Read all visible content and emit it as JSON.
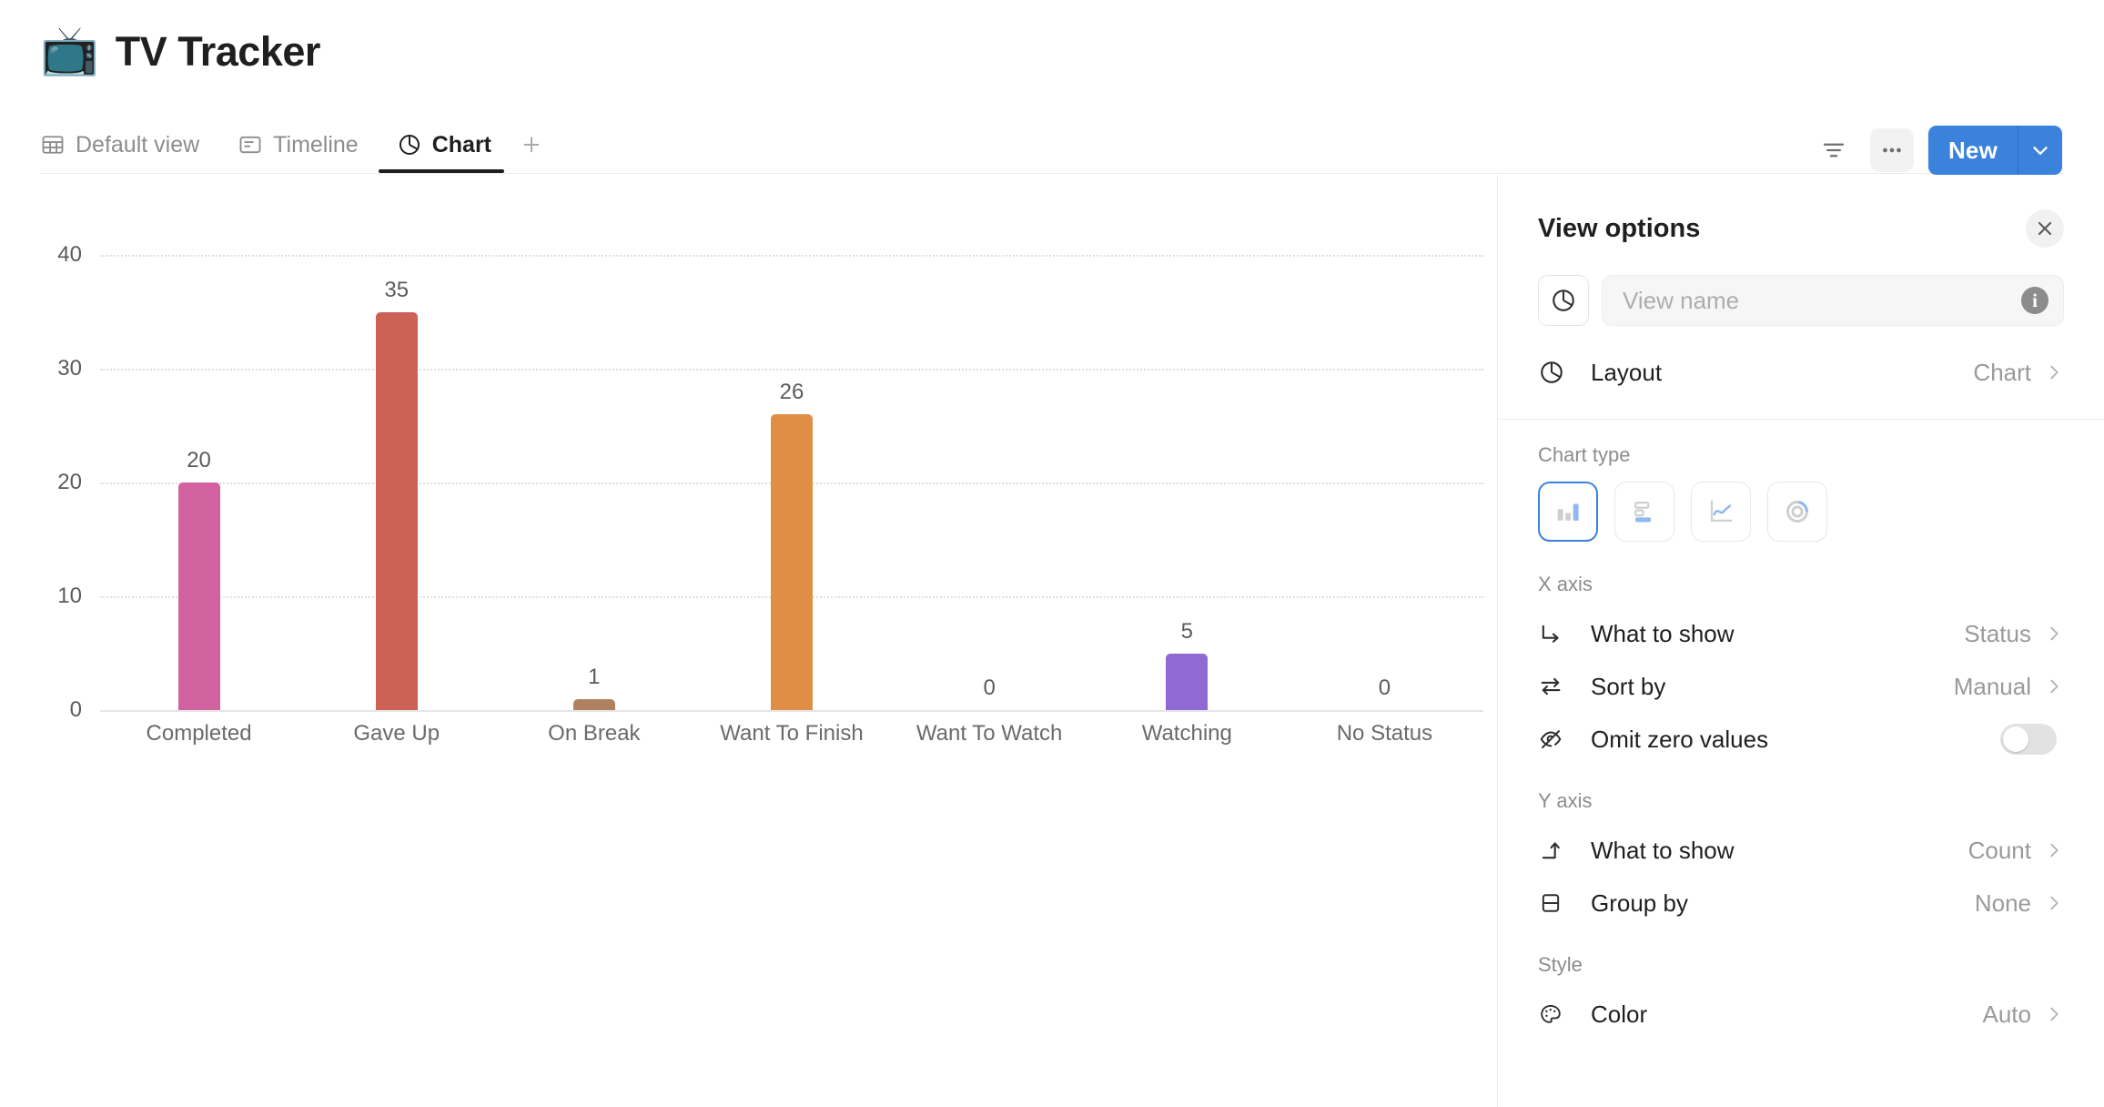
{
  "header": {
    "emoji": "📺",
    "title": "TV Tracker"
  },
  "tabs": [
    {
      "label": "Default view",
      "icon": "table-icon",
      "active": false
    },
    {
      "label": "Timeline",
      "icon": "timeline-icon",
      "active": false
    },
    {
      "label": "Chart",
      "icon": "chart-pie-icon",
      "active": true
    }
  ],
  "tabbar": {
    "add_label": "+"
  },
  "toolbar": {
    "filter_icon": "filter-icon",
    "more_icon": "ellipsis-icon",
    "new_label": "New",
    "new_caret_icon": "chevron-down-icon",
    "accent_color": "#3b82dd"
  },
  "panel": {
    "title": "View options",
    "close_icon": "close-icon",
    "view_name_value": "",
    "view_name_placeholder": "View name",
    "view_name_icon": "chart-pie-icon",
    "info_icon": "info-icon",
    "layout": {
      "label": "Layout",
      "value": "Chart",
      "icon": "chart-pie-icon"
    },
    "chart_type": {
      "section_label": "Chart type",
      "options": [
        {
          "name": "column-chart-icon",
          "selected": true
        },
        {
          "name": "bar-chart-icon",
          "selected": false
        },
        {
          "name": "line-chart-icon",
          "selected": false
        },
        {
          "name": "donut-chart-icon",
          "selected": false
        }
      ]
    },
    "x_axis": {
      "section_label": "X axis",
      "rows": [
        {
          "label": "What to show",
          "value": "Status",
          "icon": "arrow-turn-down-right-icon",
          "type": "nav"
        },
        {
          "label": "Sort by",
          "value": "Manual",
          "icon": "sort-swap-icon",
          "type": "nav"
        },
        {
          "label": "Omit zero values",
          "value": "",
          "icon": "eye-off-icon",
          "type": "toggle",
          "on": false
        }
      ]
    },
    "y_axis": {
      "section_label": "Y axis",
      "rows": [
        {
          "label": "What to show",
          "value": "Count",
          "icon": "arrow-turn-up-icon",
          "type": "nav"
        },
        {
          "label": "Group by",
          "value": "None",
          "icon": "group-rows-icon",
          "type": "nav"
        }
      ]
    },
    "style": {
      "section_label": "Style",
      "rows": [
        {
          "label": "Color",
          "value": "Auto",
          "icon": "palette-icon",
          "type": "nav"
        }
      ]
    }
  },
  "chart_data": {
    "type": "bar",
    "title": "",
    "xlabel": "",
    "ylabel": "",
    "categories": [
      "Completed",
      "Gave Up",
      "On Break",
      "Want To Finish",
      "Want To Watch",
      "Watching",
      "No Status"
    ],
    "values": [
      20,
      35,
      1,
      26,
      0,
      5,
      0
    ],
    "colors": [
      "#d2629f",
      "#cc6156",
      "#b08160",
      "#e08e46",
      "#cccccc",
      "#9069d4",
      "#cccccc"
    ],
    "ylim": [
      0,
      40
    ],
    "yticks": [
      0,
      10,
      20,
      30,
      40
    ],
    "grid": true,
    "legend": "none",
    "data_labels": true
  }
}
